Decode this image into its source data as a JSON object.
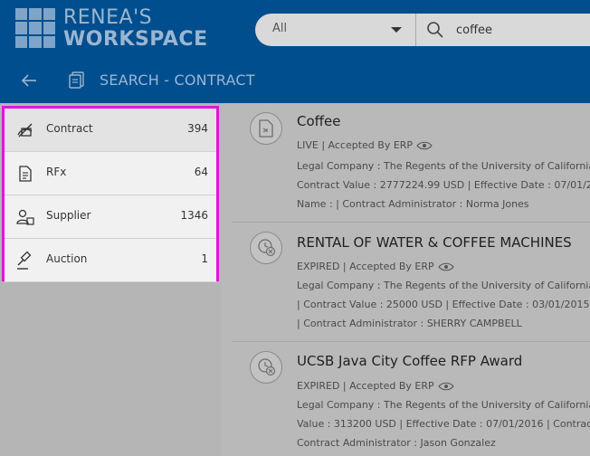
{
  "header": {
    "logo_line1": "RENEA'S",
    "logo_line2": "WORKSPACE",
    "search": {
      "scope": "All",
      "query": "coffee"
    },
    "page_title": "SEARCH - CONTRACT"
  },
  "sidebar": {
    "items": [
      {
        "label": "Contract",
        "count": "394",
        "icon": "contract-icon",
        "active": true
      },
      {
        "label": "RFx",
        "count": "64",
        "icon": "rfx-document-icon"
      },
      {
        "label": "Supplier",
        "count": "1346",
        "icon": "supplier-icon"
      },
      {
        "label": "Auction",
        "count": "1",
        "icon": "auction-gavel-icon"
      }
    ]
  },
  "results": [
    {
      "title": "Coffee",
      "status": "LIVE | Accepted By ERP",
      "line1": "Legal Company : The Regents of the University of California",
      "line2": "Contract Value : 2777224.99 USD | Effective Date : 07/01/2",
      "line3": "Name : | Contract Administrator : Norma Jones"
    },
    {
      "title": "RENTAL OF WATER & COFFEE MACHINES",
      "status": "EXPIRED | Accepted By ERP",
      "line1": "Legal Company : The Regents of the University of California",
      "line2": "| Contract Value : 25000 USD | Effective Date : 03/01/2015",
      "line3": "| Contract Administrator : SHERRY CAMPBELL"
    },
    {
      "title": "UCSB Java City Coffee RFP Award",
      "status": "EXPIRED | Accepted By ERP",
      "line1": "Legal Company : The Regents of the University of California",
      "line2": "Value : 313200 USD | Effective Date : 07/01/2016 | Contrac",
      "line3": "Contract Administrator : Jason Gonzalez"
    }
  ]
}
